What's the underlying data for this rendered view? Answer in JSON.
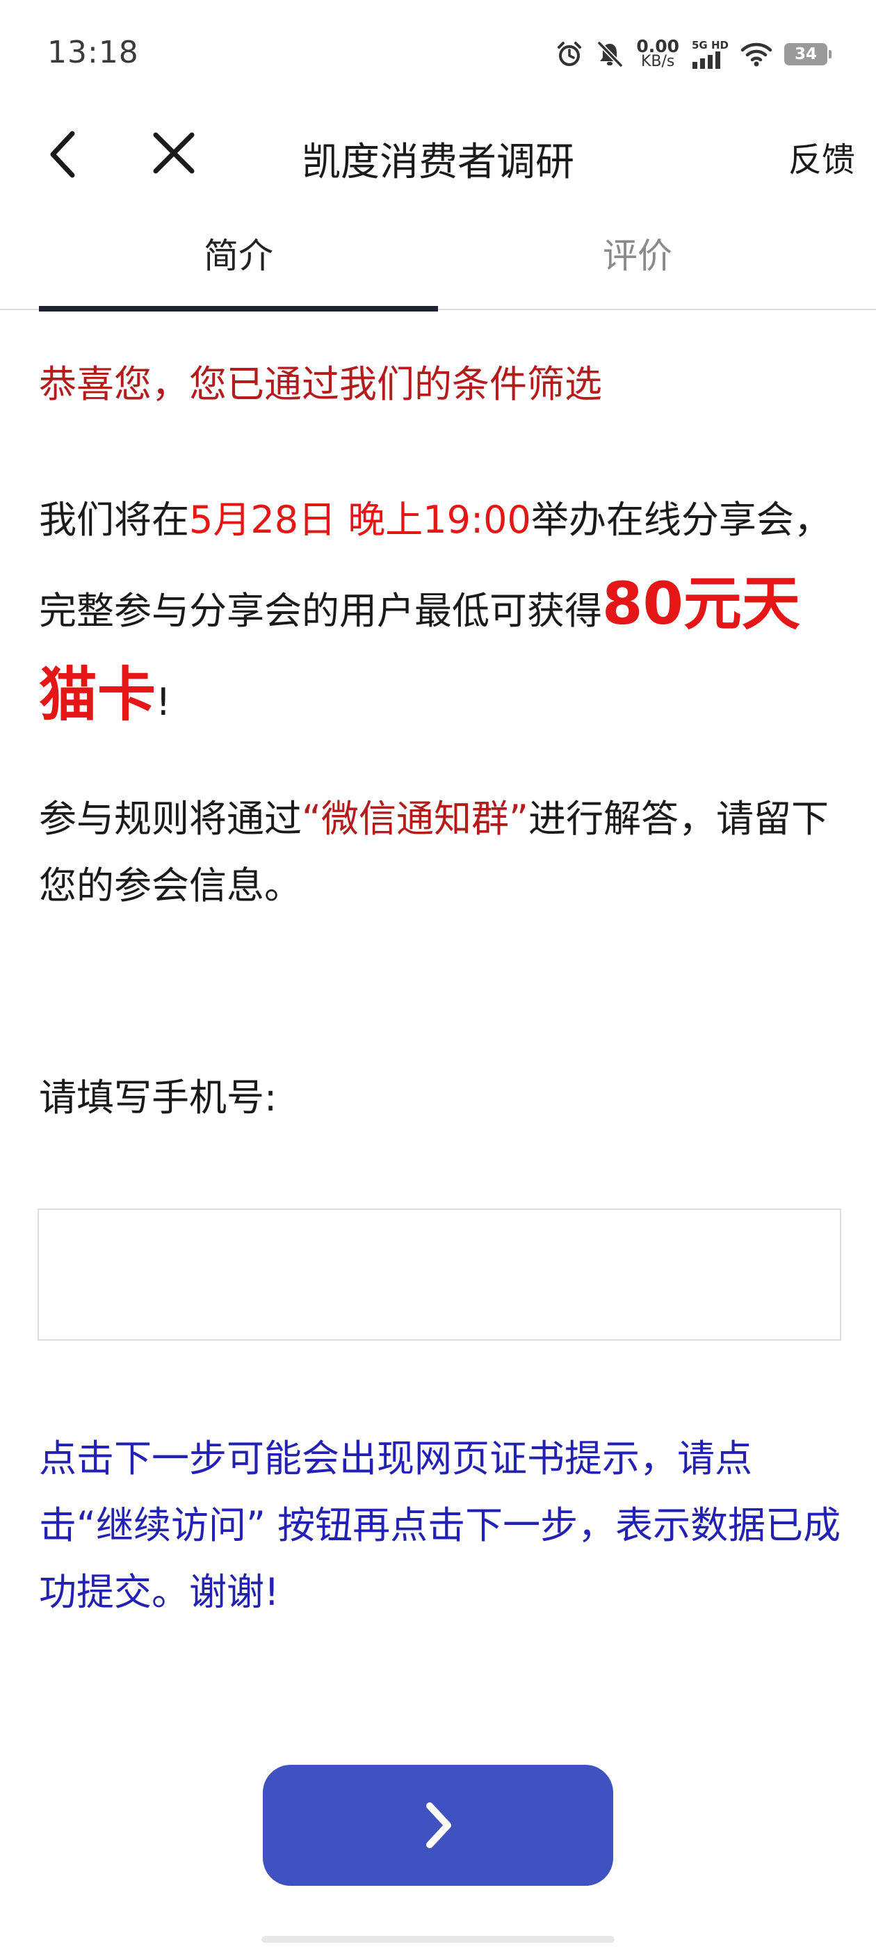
{
  "status_bar": {
    "time": "13:18",
    "net_speed_value": "0.00",
    "net_speed_unit": "KB/s",
    "network_top": "5G",
    "network_hd": "HD",
    "battery": "34",
    "icons": [
      "alarm-icon",
      "mute-icon",
      "signal-icon",
      "wifi-icon",
      "battery-icon"
    ]
  },
  "header": {
    "title": "凯度消费者调研",
    "feedback_label": "反馈",
    "back_icon": "chevron-left-icon",
    "close_icon": "close-icon"
  },
  "tabs": [
    {
      "label": "简介",
      "active": true
    },
    {
      "label": "评价",
      "active": false
    }
  ],
  "content": {
    "congrats": "恭喜您，您已通过我们的条件筛选",
    "event": {
      "prefix": "我们将在",
      "datetime": "5月28日 晚上19:00",
      "middle": "举办在线分享会，完整参与分享会的用户最低可获得",
      "reward": "80元天猫卡",
      "suffix": "!"
    },
    "rules": {
      "prefix": "参与规则将通过",
      "channel": "“微信通知群”",
      "suffix": "进行解答，请留下您的参会信息。"
    },
    "phone_label": "请填写手机号:",
    "phone_value": "",
    "notice": "点击下一步可能会出现网页证书提示，请点击“继续访问” 按钮再点击下一步，表示数据已成功提交。谢谢!"
  },
  "next_button": {
    "icon": "chevron-right-icon"
  },
  "colors": {
    "accent_red": "#e41616",
    "dark_red": "#b41c1c",
    "notice_blue": "#2321b3",
    "button_blue": "#4052bf"
  }
}
